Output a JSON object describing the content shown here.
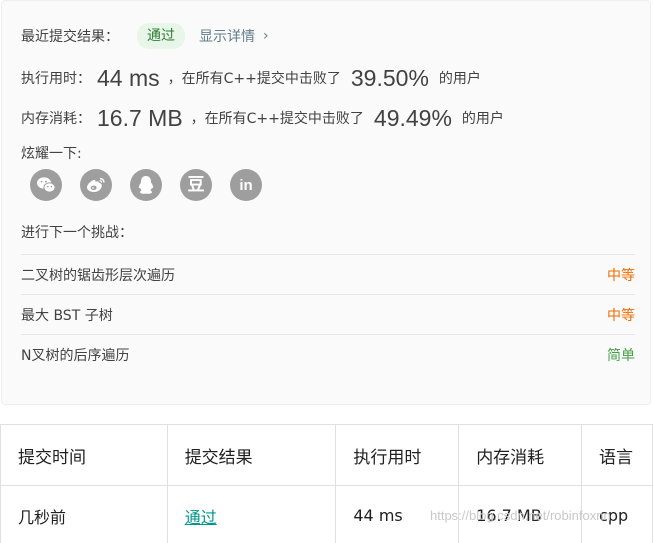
{
  "result": {
    "label": "最近提交结果：",
    "status": "通过",
    "details_link": "显示详情",
    "details_chevron": "›"
  },
  "runtime": {
    "label": "执行用时：",
    "value": "44 ms",
    "beat_text": "，在所有C++提交中击败了",
    "percent": "39.50%",
    "tail": "的用户"
  },
  "memory": {
    "label": "内存消耗：",
    "value": "16.7 MB",
    "beat_text": "，在所有C++提交中击败了",
    "percent": "49.49%",
    "tail": "的用户"
  },
  "share": {
    "label": "炫耀一下:",
    "icons": [
      "wechat-icon",
      "weibo-icon",
      "qq-icon",
      "douban-icon",
      "linkedin-icon"
    ],
    "douban_glyph": "豆",
    "linkedin_glyph": "in"
  },
  "next": {
    "label": "进行下一个挑战：",
    "problems": [
      {
        "name": "二叉树的锯齿形层次遍历",
        "difficulty": "中等",
        "color": "#ef6c00"
      },
      {
        "name": "最大 BST 子树",
        "difficulty": "中等",
        "color": "#ef6c00"
      },
      {
        "name": "N叉树的后序遍历",
        "difficulty": "简单",
        "color": "#43a047"
      }
    ]
  },
  "table": {
    "headers": [
      "提交时间",
      "提交结果",
      "执行用时",
      "内存消耗",
      "语言"
    ],
    "rows": [
      {
        "time": "几秒前",
        "result": "通过",
        "runtime": "44 ms",
        "memory": "16.7 MB",
        "language": "cpp"
      }
    ]
  },
  "watermark": "https://blog.csdn.net/robinfoxnn"
}
